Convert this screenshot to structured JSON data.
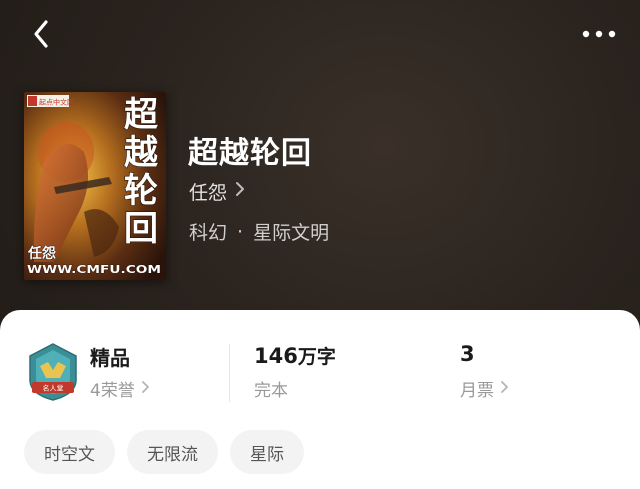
{
  "nav": {
    "back_icon": "chevron-left-icon",
    "more_icon": "more-dots-icon"
  },
  "book": {
    "title": "超越轮回",
    "author": "任怨",
    "category": "科幻",
    "separator": "·",
    "subcategory": "星际文明",
    "cover": {
      "big_title": "超越轮回",
      "author": "任怨",
      "site_url": "WWW.CMFU.COM",
      "site_logo": "起点中文网"
    }
  },
  "stats": {
    "quality": {
      "label": "精品",
      "honor": "4荣誉",
      "badge_icon": "shield-badge-icon",
      "badge_ribbon": "名人堂"
    },
    "words": {
      "value": "146",
      "unit": "万字",
      "status": "完本"
    },
    "tickets": {
      "value": "3",
      "label": "月票"
    }
  },
  "tags": [
    "时空文",
    "无限流",
    "星际"
  ],
  "colors": {
    "header_bg": "#2a231e",
    "card_bg": "#ffffff",
    "tag_bg": "#f3f3f3",
    "muted_text": "#9a9a9a",
    "badge_teal": "#3a8f96",
    "badge_red": "#c0392b"
  }
}
